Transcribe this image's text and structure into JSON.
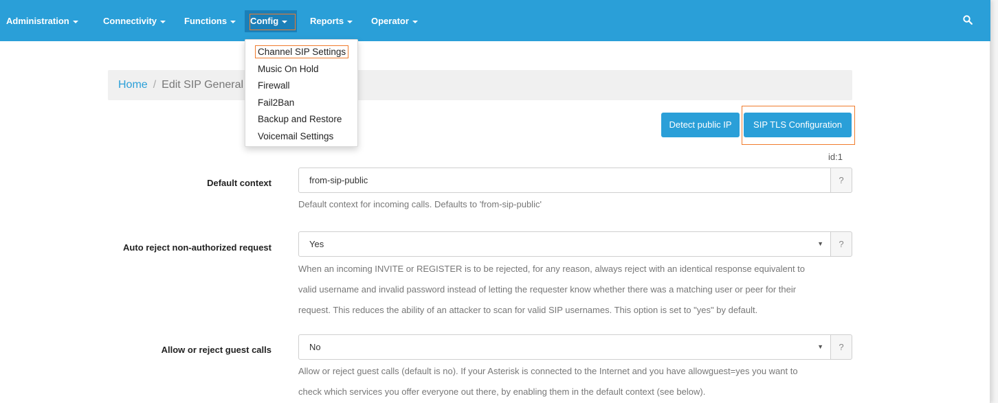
{
  "navbar": {
    "items": [
      {
        "label": "Administration"
      },
      {
        "label": "Connectivity"
      },
      {
        "label": "Functions"
      },
      {
        "label": "Config"
      },
      {
        "label": "Reports"
      },
      {
        "label": "Operator"
      }
    ],
    "search_icon": "search-icon"
  },
  "config_menu": {
    "items": [
      {
        "label": "Channel SIP Settings"
      },
      {
        "label": "Music On Hold"
      },
      {
        "label": "Firewall"
      },
      {
        "label": "Fail2Ban"
      },
      {
        "label": "Backup and Restore"
      },
      {
        "label": "Voicemail Settings"
      }
    ]
  },
  "breadcrumb": {
    "home": "Home",
    "separator": "/",
    "current": "Edit SIP General Settings"
  },
  "actions": {
    "detect": "Detect public IP",
    "tls": "SIP TLS Configuration"
  },
  "record_id": "id:1",
  "form": {
    "default_context": {
      "label": "Default context",
      "value": "from-sip-public",
      "help_button": "?",
      "help": "Default context for incoming calls. Defaults to 'from-sip-public'"
    },
    "auto_reject": {
      "label": "Auto reject non-authorized request",
      "value": "Yes",
      "help_button": "?",
      "help_lines": [
        "When an incoming INVITE or REGISTER is to be rejected, for any reason, always reject with an identical response equivalent to",
        "valid username and invalid password instead of letting the requester know whether there was a matching user or peer for their",
        "request. This reduces the ability of an attacker to scan for valid SIP usernames. This option is set to \"yes\" by default."
      ]
    },
    "guest_calls": {
      "label": "Allow or reject guest calls",
      "value": "No",
      "help_button": "?",
      "help_lines": [
        "Allow or reject guest calls (default is no). If your Asterisk is connected to the Internet and you have allowguest=yes you want to",
        "check which services you offer everyone out there, by enabling them in the default context (see below)."
      ]
    }
  },
  "colors": {
    "navbar": "#2a9fd8",
    "highlight": "#f07b2b",
    "link": "#2a9fd8"
  }
}
